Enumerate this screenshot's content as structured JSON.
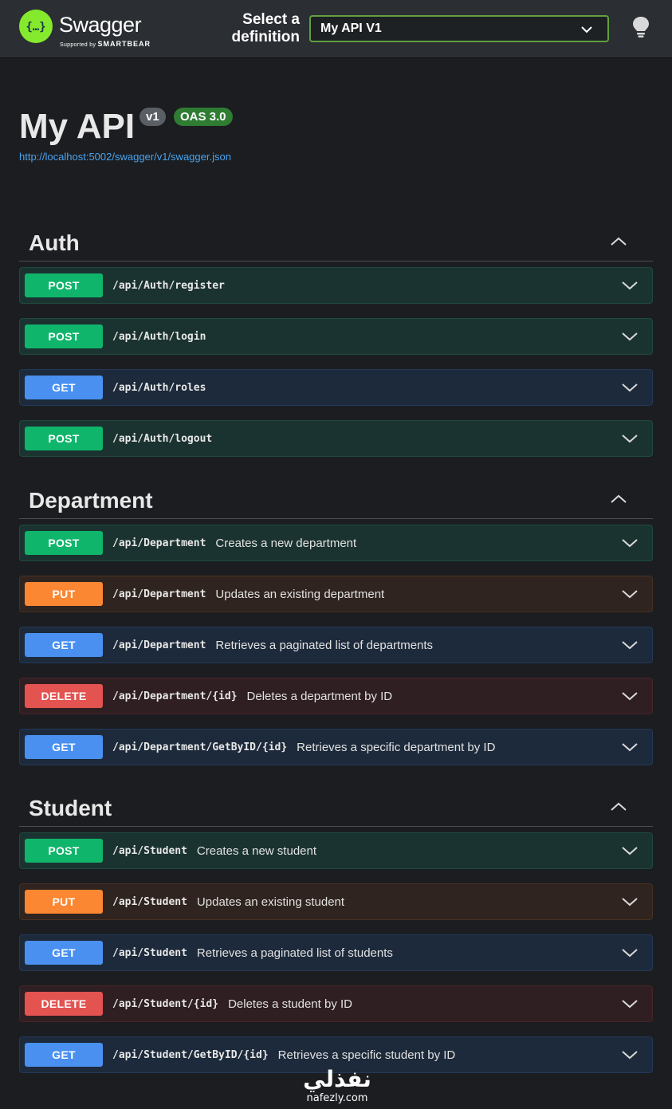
{
  "topbar": {
    "brand": "Swagger",
    "supported_by": "Supported by",
    "smartbear": "SMARTBEAR",
    "select_label_line1": "Select a",
    "select_label_line2": "definition",
    "selected_definition": "My API V1",
    "icons": [
      "swagger-logo-icon",
      "chevron-down-icon",
      "lightbulb-icon"
    ]
  },
  "info": {
    "title": "My API",
    "version_badge": "v1",
    "oas_badge": "OAS 3.0",
    "spec_link": "http://localhost:5002/swagger/v1/swagger.json"
  },
  "colors": {
    "post": "#10b56c",
    "get": "#4990f0",
    "put": "#fb8733",
    "delete": "#e35350",
    "accent_logo": "#85ea2d"
  },
  "sections": [
    {
      "name": "Auth",
      "operations": [
        {
          "method": "POST",
          "path": "/api/Auth/register",
          "summary": ""
        },
        {
          "method": "POST",
          "path": "/api/Auth/login",
          "summary": ""
        },
        {
          "method": "GET",
          "path": "/api/Auth/roles",
          "summary": ""
        },
        {
          "method": "POST",
          "path": "/api/Auth/logout",
          "summary": ""
        }
      ]
    },
    {
      "name": "Department",
      "operations": [
        {
          "method": "POST",
          "path": "/api/Department",
          "summary": "Creates a new department"
        },
        {
          "method": "PUT",
          "path": "/api/Department",
          "summary": "Updates an existing department"
        },
        {
          "method": "GET",
          "path": "/api/Department",
          "summary": "Retrieves a paginated list of departments"
        },
        {
          "method": "DELETE",
          "path": "/api/Department/{id}",
          "summary": "Deletes a department by ID"
        },
        {
          "method": "GET",
          "path": "/api/Department/GetByID/{id}",
          "summary": "Retrieves a specific department by ID"
        }
      ]
    },
    {
      "name": "Student",
      "operations": [
        {
          "method": "POST",
          "path": "/api/Student",
          "summary": "Creates a new student"
        },
        {
          "method": "PUT",
          "path": "/api/Student",
          "summary": "Updates an existing student"
        },
        {
          "method": "GET",
          "path": "/api/Student",
          "summary": "Retrieves a paginated list of students"
        },
        {
          "method": "DELETE",
          "path": "/api/Student/{id}",
          "summary": "Deletes a student by ID"
        },
        {
          "method": "GET",
          "path": "/api/Student/GetByID/{id}",
          "summary": "Retrieves a specific student by ID"
        }
      ]
    }
  ],
  "watermark": {
    "arabic": "نفذلي",
    "latin": "nafezly.com"
  }
}
